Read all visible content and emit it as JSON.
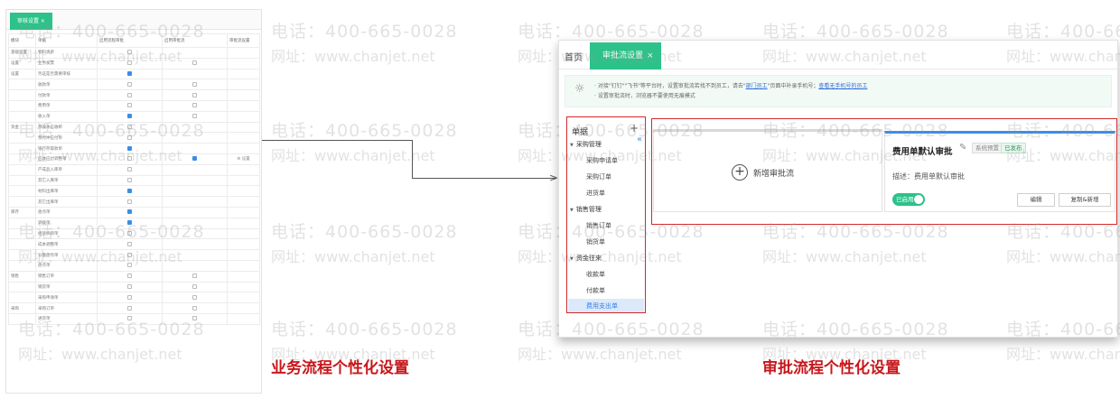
{
  "watermark": {
    "phone": "电话：400-665-0028",
    "site": "网址：www.chanjet.net"
  },
  "left": {
    "tab": "审核设置 ×",
    "headers": [
      "模块",
      "单据",
      "启用流程审批",
      "启用审批流",
      "审批流设置"
    ],
    "rows": [
      {
        "module": "基础设置",
        "doc": "物料清单",
        "c1": "off",
        "c2": "",
        "c3": ""
      },
      {
        "module": "设置",
        "doc": "业务发票",
        "c1": "off",
        "c2": "off",
        "c3": ""
      },
      {
        "module": "设置",
        "doc": "凭证是否需要审核",
        "c1": "on",
        "c2": "",
        "c3": ""
      },
      {
        "module": "",
        "doc": "收款单",
        "c1": "off",
        "c2": "off",
        "c3": ""
      },
      {
        "module": "",
        "doc": "付款单",
        "c1": "off",
        "c2": "off",
        "c3": ""
      },
      {
        "module": "",
        "doc": "费用单",
        "c1": "off",
        "c2": "off",
        "c3": ""
      },
      {
        "module": "",
        "doc": "收入单",
        "c1": "on",
        "c2": "off",
        "c3": ""
      },
      {
        "module": "资金",
        "doc": "预收冲应收单",
        "c1": "off",
        "c2": "",
        "c3": ""
      },
      {
        "module": "",
        "doc": "预付冲应付单",
        "c1": "off",
        "c2": "",
        "c3": ""
      },
      {
        "module": "",
        "doc": "银行存取款单",
        "c1": "on",
        "c2": "",
        "c3": ""
      },
      {
        "module": "",
        "doc": "应收应付调整单",
        "c1": "off",
        "c2": "on",
        "c3": "⚙ 设置"
      },
      {
        "module": "",
        "doc": "产成品入库单",
        "c1": "off",
        "c2": "",
        "c3": ""
      },
      {
        "module": "",
        "doc": "其它入库单",
        "c1": "off",
        "c2": "",
        "c3": ""
      },
      {
        "module": "",
        "doc": "材料出库单",
        "c1": "on",
        "c2": "",
        "c3": ""
      },
      {
        "module": "",
        "doc": "其它出库单",
        "c1": "off",
        "c2": "",
        "c3": ""
      },
      {
        "module": "库存",
        "doc": "盘点单",
        "c1": "on",
        "c2": "",
        "c3": ""
      },
      {
        "module": "",
        "doc": "调拨单",
        "c1": "on",
        "c2": "",
        "c3": ""
      },
      {
        "module": "",
        "doc": "组装拆卸单",
        "c1": "off",
        "c2": "",
        "c3": ""
      },
      {
        "module": "",
        "doc": "成本调整单",
        "c1": "off",
        "c2": "",
        "c3": ""
      },
      {
        "module": "",
        "doc": "分量盘点单",
        "c1": "off",
        "c2": "",
        "c3": ""
      },
      {
        "module": "",
        "doc": "盘点单",
        "c1": "off",
        "c2": "",
        "c3": ""
      },
      {
        "module": "销售",
        "doc": "销售订单",
        "c1": "off",
        "c2": "off",
        "c3": ""
      },
      {
        "module": "",
        "doc": "销货单",
        "c1": "off",
        "c2": "off",
        "c3": ""
      },
      {
        "module": "",
        "doc": "采购申请单",
        "c1": "off",
        "c2": "off",
        "c3": ""
      },
      {
        "module": "采购",
        "doc": "采购订单",
        "c1": "off",
        "c2": "off",
        "c3": ""
      },
      {
        "module": "",
        "doc": "进货单",
        "c1": "off",
        "c2": "off",
        "c3": ""
      }
    ]
  },
  "captions": {
    "left": "业务流程个性化设置",
    "right": "审批流程个性化设置"
  },
  "right": {
    "home": "首页",
    "tab": "审批流设置",
    "tab_close": "×",
    "notice_1": "· 对接\"钉钉\"\"飞书\"等平台时，设置审批流若找不到员工，请去\"",
    "notice_link1": "部门员工",
    "notice_mid": "\"页面中补录手机号；",
    "notice_link2": "查看无手机号的员工",
    "notice_2": "· 设置审批流时，浏览器不要使用无痕模式",
    "tree_head": "单据",
    "tree_plus": "+",
    "tree_collapse": "«",
    "tree": {
      "g1": "采购管理",
      "g1a": "采购申请单",
      "g1b": "采购订单",
      "g1c": "进货单",
      "g2": "销售管理",
      "g2a": "销售订单",
      "g2b": "销货单",
      "g3": "资金往来",
      "g3a": "收款单",
      "g3b": "付款单",
      "g3c": "费用支出单"
    },
    "add_label": "新增审批流",
    "card_title": "费用单默认审批",
    "tag_sys": "系统预置",
    "tag_pub": "已发布",
    "card_desc": "描述：费用单默认审批",
    "toggle": "已启用",
    "btn_edit": "编辑",
    "btn_copy": "复制&新增"
  }
}
